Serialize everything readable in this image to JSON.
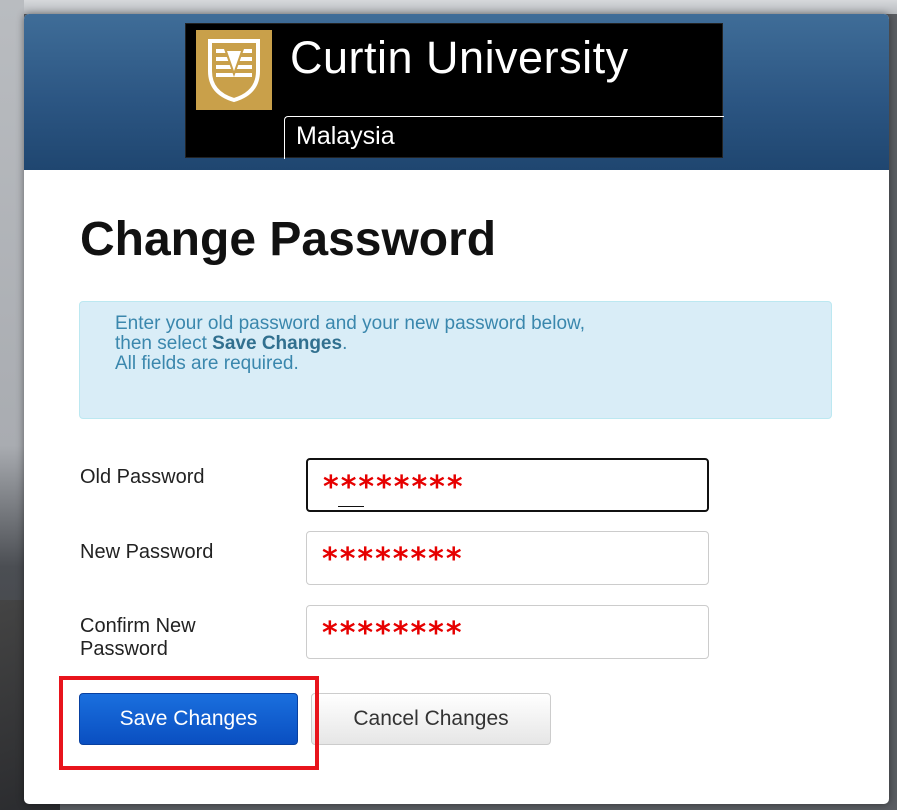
{
  "header": {
    "logo_name": "Curtin University",
    "logo_sub": "Malaysia",
    "brand_color": "#2c5683",
    "crest_color": "#c9a04a"
  },
  "title": "Change Password",
  "info": {
    "line1": "Enter your old password and your new password below,",
    "line2_prefix": "then select ",
    "line2_bold": "Save Changes",
    "line2_suffix": ".",
    "line3": "All fields are required."
  },
  "fields": [
    {
      "label": "Old Password",
      "value": "********"
    },
    {
      "label": "New Password",
      "value": "********"
    },
    {
      "label_line1": "Confirm New",
      "label_line2": "Password",
      "value": "********"
    }
  ],
  "buttons": {
    "save": "Save Changes",
    "cancel": "Cancel Changes"
  },
  "colors": {
    "mask_text": "#e60000",
    "save_button": "#0a4fc1",
    "annotation_highlight": "#e8141c",
    "info_bg": "#d9edf7",
    "info_text": "#3a87ad"
  }
}
